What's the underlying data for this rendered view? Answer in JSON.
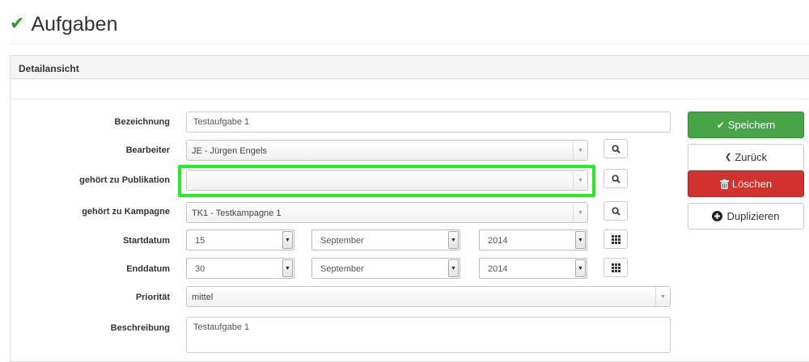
{
  "page": {
    "title": "Aufgaben",
    "title_icon": "checkmark-icon"
  },
  "panel": {
    "heading": "Detailansicht"
  },
  "form": {
    "bezeichnung": {
      "label": "Bezeichnung",
      "value": "Testaufgabe 1"
    },
    "bearbeiter": {
      "label": "Bearbeiter",
      "value": "JE - Jürgen Engels"
    },
    "publikation": {
      "label": "gehört zu Publikation",
      "value": ""
    },
    "kampagne": {
      "label": "gehört zu Kampagne",
      "value": "TK1 - Testkampagne 1"
    },
    "startdatum": {
      "label": "Startdatum",
      "day": "15",
      "month": "September",
      "year": "2014"
    },
    "enddatum": {
      "label": "Enddatum",
      "day": "30",
      "month": "September",
      "year": "2014"
    },
    "prioritaet": {
      "label": "Priorität",
      "value": "mittel"
    },
    "beschreibung": {
      "label": "Beschreibung",
      "value": "Testaufgabe 1"
    }
  },
  "actions": {
    "save": "Speichern",
    "back": "Zurück",
    "delete": "Löschen",
    "duplicate": "Duplizieren"
  },
  "colors": {
    "success": "#47a447",
    "danger": "#d2322d",
    "highlight": "#22ee22"
  }
}
